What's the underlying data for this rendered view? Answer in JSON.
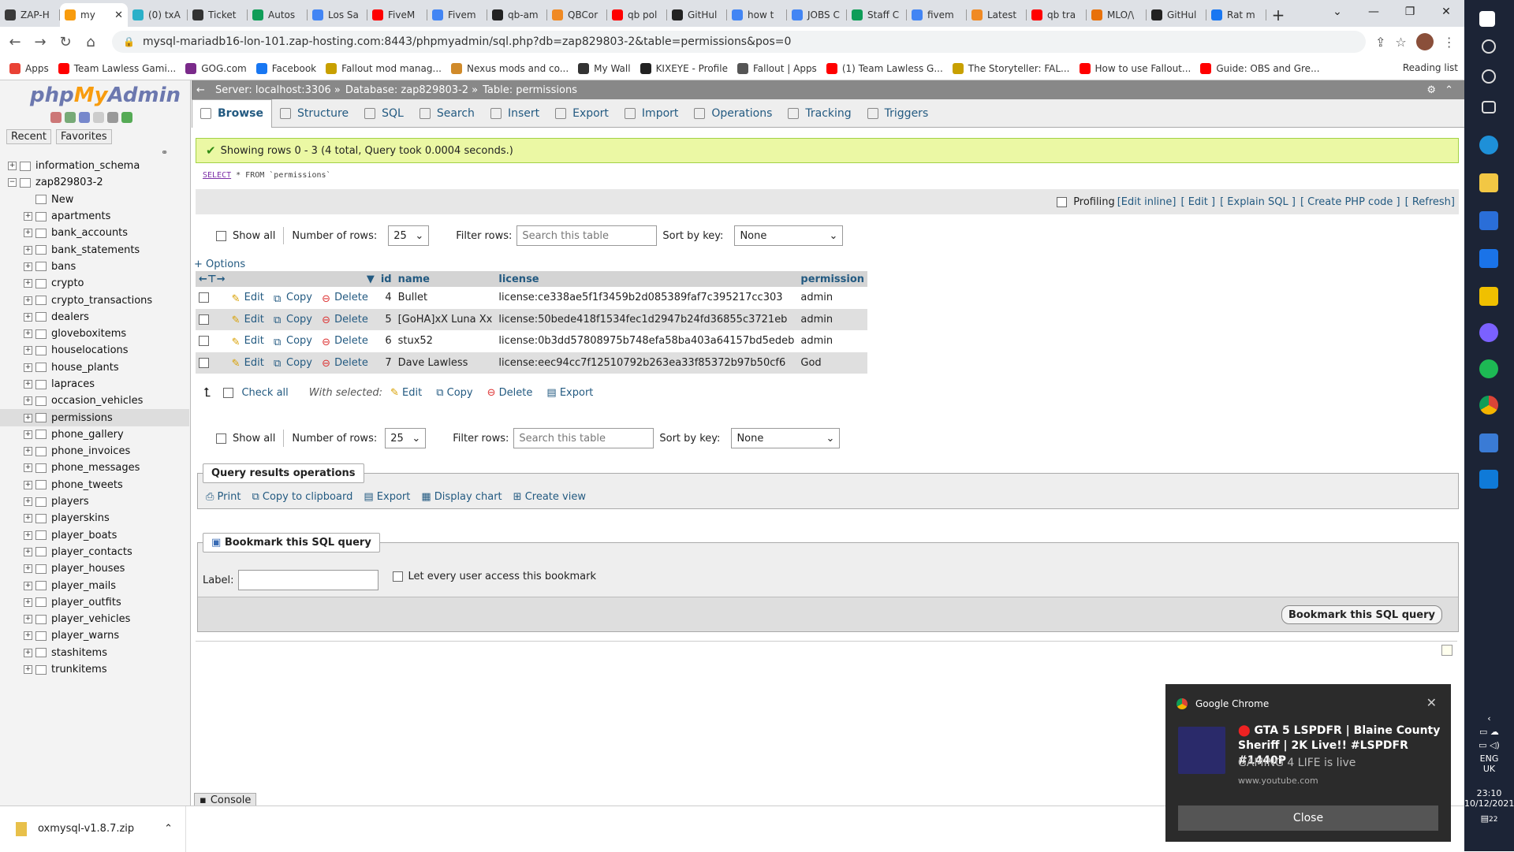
{
  "browser": {
    "tabs": [
      {
        "label": "ZAP-H",
        "color": "#3a3a3a"
      },
      {
        "label": "my",
        "color": "#f89c0e",
        "active": true
      },
      {
        "label": "(0) txA",
        "color": "#2ab0c9"
      },
      {
        "label": "Ticket",
        "color": "#333333"
      },
      {
        "label": "Autos",
        "color": "#0f9d58"
      },
      {
        "label": "Los Sa",
        "color": "#4285f4"
      },
      {
        "label": "FiveM",
        "color": "#ff0000"
      },
      {
        "label": "Fivem",
        "color": "#4285f4"
      },
      {
        "label": "qb-am",
        "color": "#222222"
      },
      {
        "label": "QBCor",
        "color": "#f08a24"
      },
      {
        "label": "qb pol",
        "color": "#ff0000"
      },
      {
        "label": "GitHul",
        "color": "#222222"
      },
      {
        "label": "how t",
        "color": "#4285f4"
      },
      {
        "label": "JOBS C",
        "color": "#4285f4"
      },
      {
        "label": "Staff C",
        "color": "#0f9d58"
      },
      {
        "label": "fivem",
        "color": "#4285f4"
      },
      {
        "label": "Latest",
        "color": "#f08a24"
      },
      {
        "label": "qb tra",
        "color": "#ff0000"
      },
      {
        "label": "MLO/\\",
        "color": "#e8710a"
      },
      {
        "label": "GitHul",
        "color": "#222222"
      },
      {
        "label": "Rat m",
        "color": "#1877f2"
      }
    ],
    "url": "mysql-mariadb16-lon-101.zap-hosting.com:8443/phpmyadmin/sql.php?db=zap829803-2&table=permissions&pos=0",
    "bookmarks": [
      {
        "label": "Apps",
        "color": "#e94235"
      },
      {
        "label": "Team Lawless Gami...",
        "color": "#ff0000"
      },
      {
        "label": "GOG.com",
        "color": "#7a2a8a"
      },
      {
        "label": "Facebook",
        "color": "#1877f2"
      },
      {
        "label": "Fallout mod manag...",
        "color": "#c8a000"
      },
      {
        "label": "Nexus mods and co...",
        "color": "#d08a2a"
      },
      {
        "label": "My Wall",
        "color": "#333333"
      },
      {
        "label": "KIXEYE - Profile",
        "color": "#222222"
      },
      {
        "label": "Fallout | Apps",
        "color": "#555555"
      },
      {
        "label": "(1) Team Lawless G...",
        "color": "#ff0000"
      },
      {
        "label": "The Storyteller: FAL...",
        "color": "#c8a000"
      },
      {
        "label": "How to use Fallout...",
        "color": "#ff0000"
      },
      {
        "label": "Guide: OBS and Gre...",
        "color": "#ff0000"
      }
    ],
    "reading_list": "Reading list"
  },
  "pma": {
    "recent": "Recent",
    "favorites": "Favorites",
    "tree": [
      {
        "label": "information_schema",
        "level": 0
      },
      {
        "label": "zap829803-2",
        "level": 0
      },
      {
        "label": "New",
        "level": 1
      },
      {
        "label": "apartments",
        "level": 1
      },
      {
        "label": "bank_accounts",
        "level": 1
      },
      {
        "label": "bank_statements",
        "level": 1
      },
      {
        "label": "bans",
        "level": 1
      },
      {
        "label": "crypto",
        "level": 1
      },
      {
        "label": "crypto_transactions",
        "level": 1
      },
      {
        "label": "dealers",
        "level": 1
      },
      {
        "label": "gloveboxitems",
        "level": 1
      },
      {
        "label": "houselocations",
        "level": 1
      },
      {
        "label": "house_plants",
        "level": 1
      },
      {
        "label": "lapraces",
        "level": 1
      },
      {
        "label": "occasion_vehicles",
        "level": 1
      },
      {
        "label": "permissions",
        "level": 1,
        "selected": true
      },
      {
        "label": "phone_gallery",
        "level": 1
      },
      {
        "label": "phone_invoices",
        "level": 1
      },
      {
        "label": "phone_messages",
        "level": 1
      },
      {
        "label": "phone_tweets",
        "level": 1
      },
      {
        "label": "players",
        "level": 1
      },
      {
        "label": "playerskins",
        "level": 1
      },
      {
        "label": "player_boats",
        "level": 1
      },
      {
        "label": "player_contacts",
        "level": 1
      },
      {
        "label": "player_houses",
        "level": 1
      },
      {
        "label": "player_mails",
        "level": 1
      },
      {
        "label": "player_outfits",
        "level": 1
      },
      {
        "label": "player_vehicles",
        "level": 1
      },
      {
        "label": "player_warns",
        "level": 1
      },
      {
        "label": "stashitems",
        "level": 1
      },
      {
        "label": "trunkitems",
        "level": 1
      }
    ],
    "breadcrumb": {
      "server": "Server: localhost:3306 »",
      "database": "Database: zap829803-2 »",
      "table": "Table: permissions"
    },
    "tabs": [
      "Browse",
      "Structure",
      "SQL",
      "Search",
      "Insert",
      "Export",
      "Import",
      "Operations",
      "Tracking",
      "Triggers"
    ],
    "success": "Showing rows 0 - 3 (4 total, Query took 0.0004 seconds.)",
    "sql": {
      "kw": "SELECT",
      "rest": " * FROM `permissions`"
    },
    "profiling": "Profiling",
    "sql_links": [
      "[Edit inline]",
      "[ Edit ]",
      "[ Explain SQL ]",
      "[ Create PHP code ]",
      "[ Refresh]"
    ],
    "controls": {
      "show_all": "Show all",
      "num_rows_label": "Number of rows:",
      "num_rows_value": "25",
      "filter_label": "Filter rows:",
      "filter_placeholder": "Search this table",
      "sort_label": "Sort by key:",
      "sort_value": "None"
    },
    "options": "+ Options",
    "columns": [
      "id",
      "name",
      "license",
      "permission"
    ],
    "rows": [
      {
        "id": "4",
        "name": "Bullet",
        "license": "license:ce338ae5f1f3459b2d085389faf7c395217cc303",
        "permission": "admin"
      },
      {
        "id": "5",
        "name": "[GoHA]xX Luna Xx",
        "license": "license:50bede418f1534fec1d2947b24fd36855c3721eb",
        "permission": "admin"
      },
      {
        "id": "6",
        "name": "stux52",
        "license": "license:0b3dd57808975b748efa58ba403a64157bd5edeb",
        "permission": "admin"
      },
      {
        "id": "7",
        "name": "Dave Lawless",
        "license": "license:eec94cc7f12510792b263ea33f85372b97b50cf6",
        "permission": "God"
      }
    ],
    "row_actions": {
      "edit": "Edit",
      "copy": "Copy",
      "delete": "Delete"
    },
    "with_selected": {
      "check_all": "Check all",
      "label": "With selected:",
      "edit": "Edit",
      "copy": "Copy",
      "delete": "Delete",
      "export": "Export"
    },
    "qro": {
      "legend": "Query results operations",
      "print": "Print",
      "copy": "Copy to clipboard",
      "export": "Export",
      "chart": "Display chart",
      "view": "Create view"
    },
    "bookmark": {
      "legend": "Bookmark this SQL query",
      "label": "Label:",
      "everyone": "Let every user access this bookmark",
      "button": "Bookmark this SQL query"
    },
    "console": "Console"
  },
  "download": {
    "file": "oxmysql-v1.8.7.zip"
  },
  "toast": {
    "app": "Google Chrome",
    "title": "GTA 5 LSPDFR | Blaine County Sheriff | 2K Live!! #LSPDFR #1440P",
    "subtitle": "GAMING 4 LIFE is live",
    "site": "www.youtube.com",
    "close": "Close"
  },
  "tray": {
    "lang": "ENG",
    "region": "UK",
    "time": "23:10",
    "date": "10/12/2021",
    "notif_count": "22"
  }
}
